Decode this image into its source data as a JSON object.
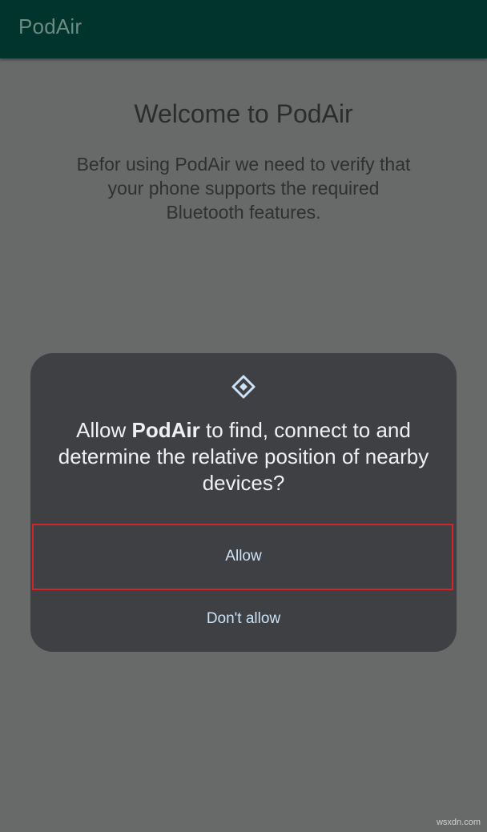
{
  "app_bar": {
    "title": "PodAir"
  },
  "welcome": {
    "title": "Welcome to PodAir",
    "body": "Befor using PodAir we need to verify that your phone supports the required Bluetooth features."
  },
  "permission_dialog": {
    "icon": "nearby-devices-icon",
    "message_prefix": "Allow ",
    "app_name": "PodAir",
    "message_suffix": " to find, connect to and determine the relative position of nearby devices?",
    "allow_label": "Allow",
    "deny_label": "Don't allow"
  },
  "highlight": {
    "color": "#d2242b",
    "target": "allow-button"
  },
  "watermark": "wsxdn.com",
  "colors": {
    "app_bar": "#00342c",
    "scrim_background": "#686a69",
    "dialog_background": "#3e4043",
    "button_text": "#cbe2f7"
  }
}
